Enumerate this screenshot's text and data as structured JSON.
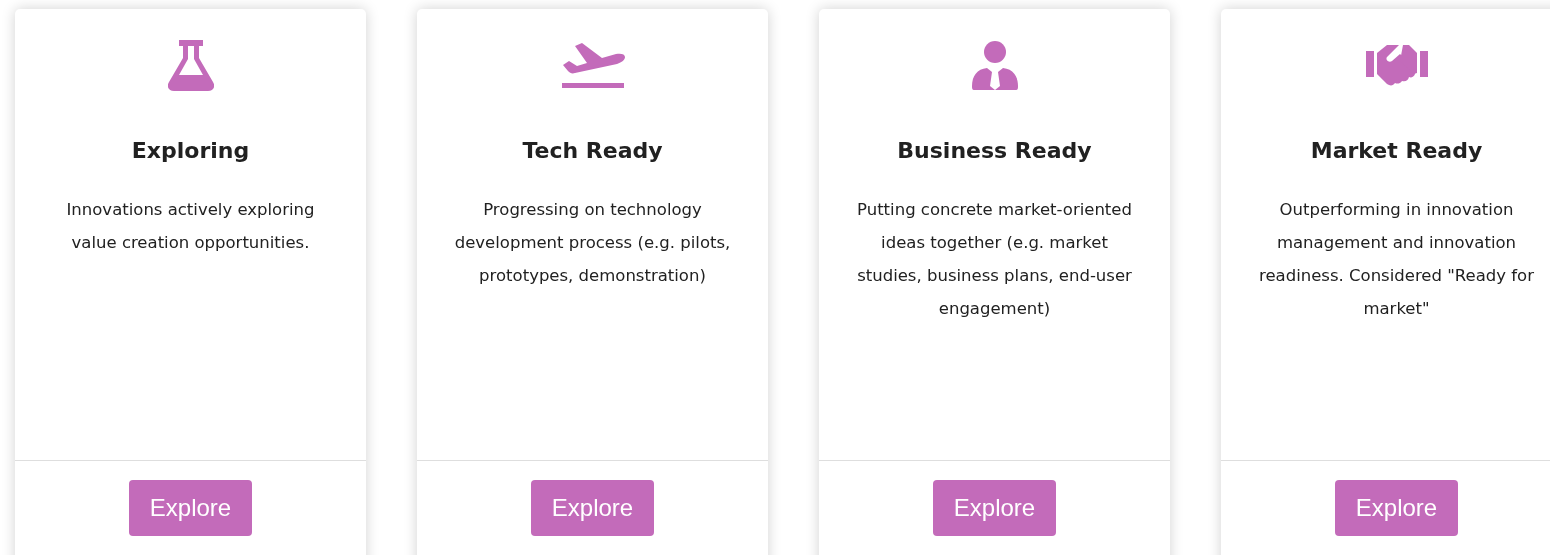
{
  "cards": [
    {
      "title": "Exploring",
      "description": "Innovations actively exploring value creation opportunities.",
      "button": "Explore"
    },
    {
      "title": "Tech Ready",
      "description": "Progressing on technology development process (e.g. pilots, prototypes, demonstration)",
      "button": "Explore"
    },
    {
      "title": "Business Ready",
      "description": "Putting concrete market-oriented ideas together (e.g. market studies, business plans, end-user engagement)",
      "button": "Explore"
    },
    {
      "title": "Market Ready",
      "description": "Outperforming in innovation management and innovation readiness. Considered \"Ready for market\"",
      "button": "Explore"
    }
  ]
}
